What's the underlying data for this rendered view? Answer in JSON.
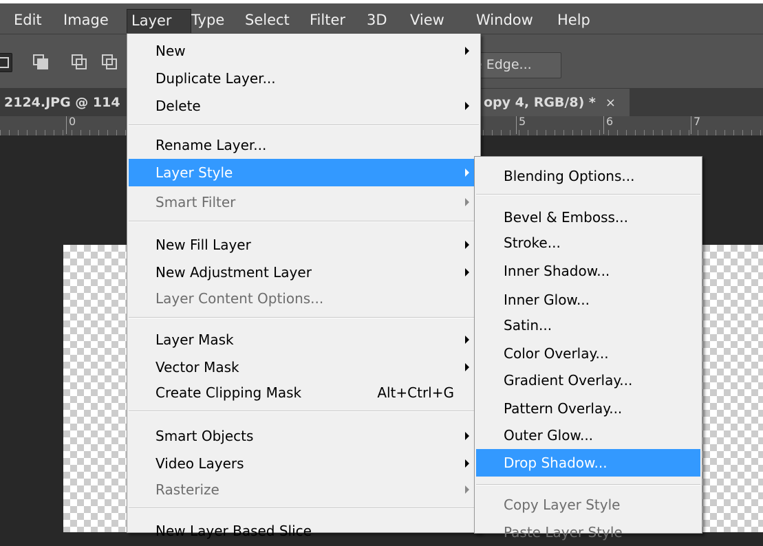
{
  "menubar": {
    "items": [
      "Edit",
      "Image",
      "Layer",
      "Type",
      "Select",
      "Filter",
      "3D",
      "View",
      "Window",
      "Help"
    ]
  },
  "options": {
    "refine_button": "e Edge..."
  },
  "tabs": {
    "left": "2124.JPG @ 114",
    "right": "opy 4, RGB/8) *",
    "close_glyph": "×"
  },
  "ruler": {
    "labels": [
      "0",
      "5",
      "6",
      "7"
    ]
  },
  "layer_menu": {
    "items": [
      {
        "label": "New",
        "submenu": true
      },
      {
        "label": "Duplicate Layer..."
      },
      {
        "label": "Delete",
        "submenu": true
      },
      {
        "label": "Rename Layer..."
      },
      {
        "label": "Layer Style",
        "submenu": true,
        "highlighted": true
      },
      {
        "label": "Smart Filter",
        "submenu": true,
        "disabled": true
      },
      {
        "label": "New Fill Layer",
        "submenu": true
      },
      {
        "label": "New Adjustment Layer",
        "submenu": true
      },
      {
        "label": "Layer Content Options...",
        "disabled": true
      },
      {
        "label": "Layer Mask",
        "submenu": true
      },
      {
        "label": "Vector Mask",
        "submenu": true
      },
      {
        "label": "Create Clipping Mask",
        "shortcut": "Alt+Ctrl+G"
      },
      {
        "label": "Smart Objects",
        "submenu": true
      },
      {
        "label": "Video Layers",
        "submenu": true
      },
      {
        "label": "Rasterize",
        "submenu": true,
        "disabled": true
      },
      {
        "label": "New Layer Based Slice"
      }
    ]
  },
  "layer_style_menu": {
    "items": [
      {
        "label": "Blending Options..."
      },
      {
        "label": "Bevel & Emboss..."
      },
      {
        "label": "Stroke..."
      },
      {
        "label": "Inner Shadow..."
      },
      {
        "label": "Inner Glow..."
      },
      {
        "label": "Satin..."
      },
      {
        "label": "Color Overlay..."
      },
      {
        "label": "Gradient Overlay..."
      },
      {
        "label": "Pattern Overlay..."
      },
      {
        "label": "Outer Glow..."
      },
      {
        "label": "Drop Shadow...",
        "highlighted": true
      },
      {
        "label": "Copy Layer Style",
        "disabled": true
      },
      {
        "label": "Paste Layer Style",
        "disabled": true
      }
    ]
  },
  "colors": {
    "highlight": "#3399ff",
    "menu_bg": "#f0f0f0",
    "chrome": "#535353"
  }
}
